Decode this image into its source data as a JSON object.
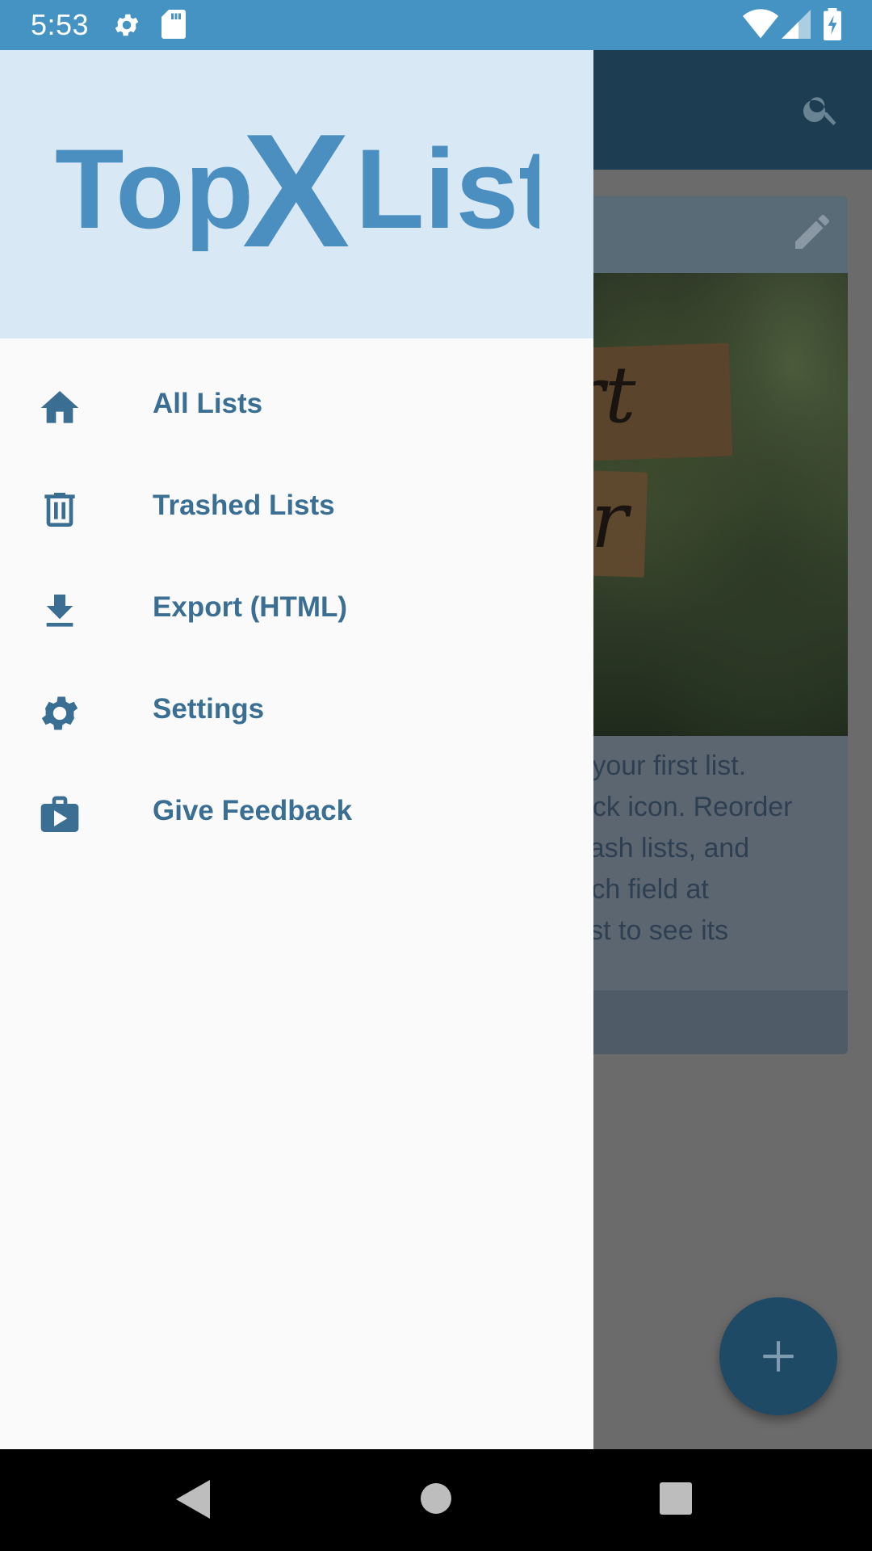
{
  "status_bar": {
    "time": "5:53",
    "icons": [
      "gear-icon",
      "sd-card-icon",
      "wifi-icon",
      "signal-icon",
      "battery-charging-icon"
    ]
  },
  "drawer": {
    "logo_text": "TopXList",
    "items": [
      {
        "label": "All Lists",
        "icon": "home-icon"
      },
      {
        "label": "Trashed Lists",
        "icon": "trash-icon"
      },
      {
        "label": "Export (HTML)",
        "icon": "download-icon"
      },
      {
        "label": "Settings",
        "icon": "gear-icon"
      },
      {
        "label": "Give Feedback",
        "icon": "feedback-icon"
      }
    ]
  },
  "background_app": {
    "card_text_lines": [
      "e your first list.",
      "eck icon. Reorder",
      " trash lists, and",
      "rch field at",
      "list to see its"
    ],
    "sign_fragments": [
      "rt",
      "ir"
    ]
  },
  "colors": {
    "accent": "#3a6f93",
    "status_bar": "#4593c2",
    "drawer_header": "#d9e8f5",
    "logo": "#4a8fc0"
  }
}
